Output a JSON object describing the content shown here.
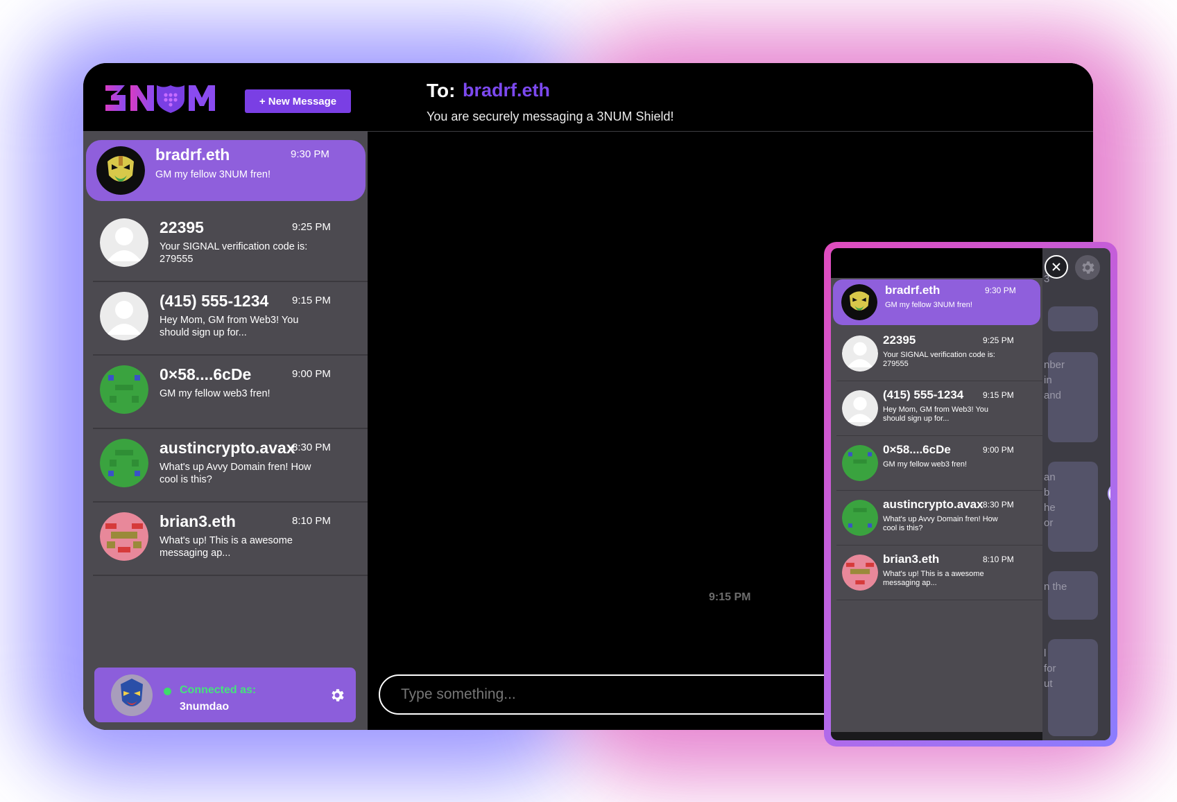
{
  "app": {
    "logo_text": "3NUM",
    "new_message_label": "+ New Message"
  },
  "conversations": [
    {
      "name": "bradrf.eth",
      "time": "9:30 PM",
      "preview": "GM my fellow 3NUM fren!",
      "avatar": "mask-icon",
      "active": true
    },
    {
      "name": "22395",
      "time": "9:25 PM",
      "preview": "Your SIGNAL verification code is: 279555",
      "avatar": "default-user-icon"
    },
    {
      "name": "(415) 555-1234",
      "time": "9:15 PM",
      "preview": "Hey Mom, GM from Web3! You should sign up for...",
      "avatar": "default-user-icon"
    },
    {
      "name": "0×58....6cDe",
      "time": "9:00 PM",
      "preview": "GM my fellow web3 fren!",
      "avatar": "green-pixel-icon"
    },
    {
      "name": "austincrypto.avax",
      "time": "8:30 PM",
      "preview": "What's up Avvy Domain fren! How cool is this?",
      "avatar": "green-pixel-icon"
    },
    {
      "name": "brian3.eth",
      "time": "8:10 PM",
      "preview": "What's up! This is a awesome messaging ap...",
      "avatar": "pink-pixel-icon"
    }
  ],
  "connected": {
    "label": "Connected as:",
    "username": "3numdao",
    "status_color": "#3ddc6b"
  },
  "chat": {
    "to_label": "To:",
    "recipient": "bradrf.eth",
    "subtitle": "You are securely messaging a 3NUM Shield!",
    "message_time": "9:15 PM",
    "input_placeholder": "Type something..."
  },
  "overlay": {
    "close_icon": "close-icon",
    "settings_icon": "gear-icon",
    "background_fragments": [
      "3",
      "nber",
      "in",
      "and",
      "an",
      "b",
      "he",
      "or",
      "n the",
      "l",
      "for",
      "ut"
    ]
  },
  "colors": {
    "accent": "#7a3fe4",
    "active_item": "#8f5fdc",
    "recipient": "#7c49ef",
    "connected_text": "#45e37c"
  }
}
